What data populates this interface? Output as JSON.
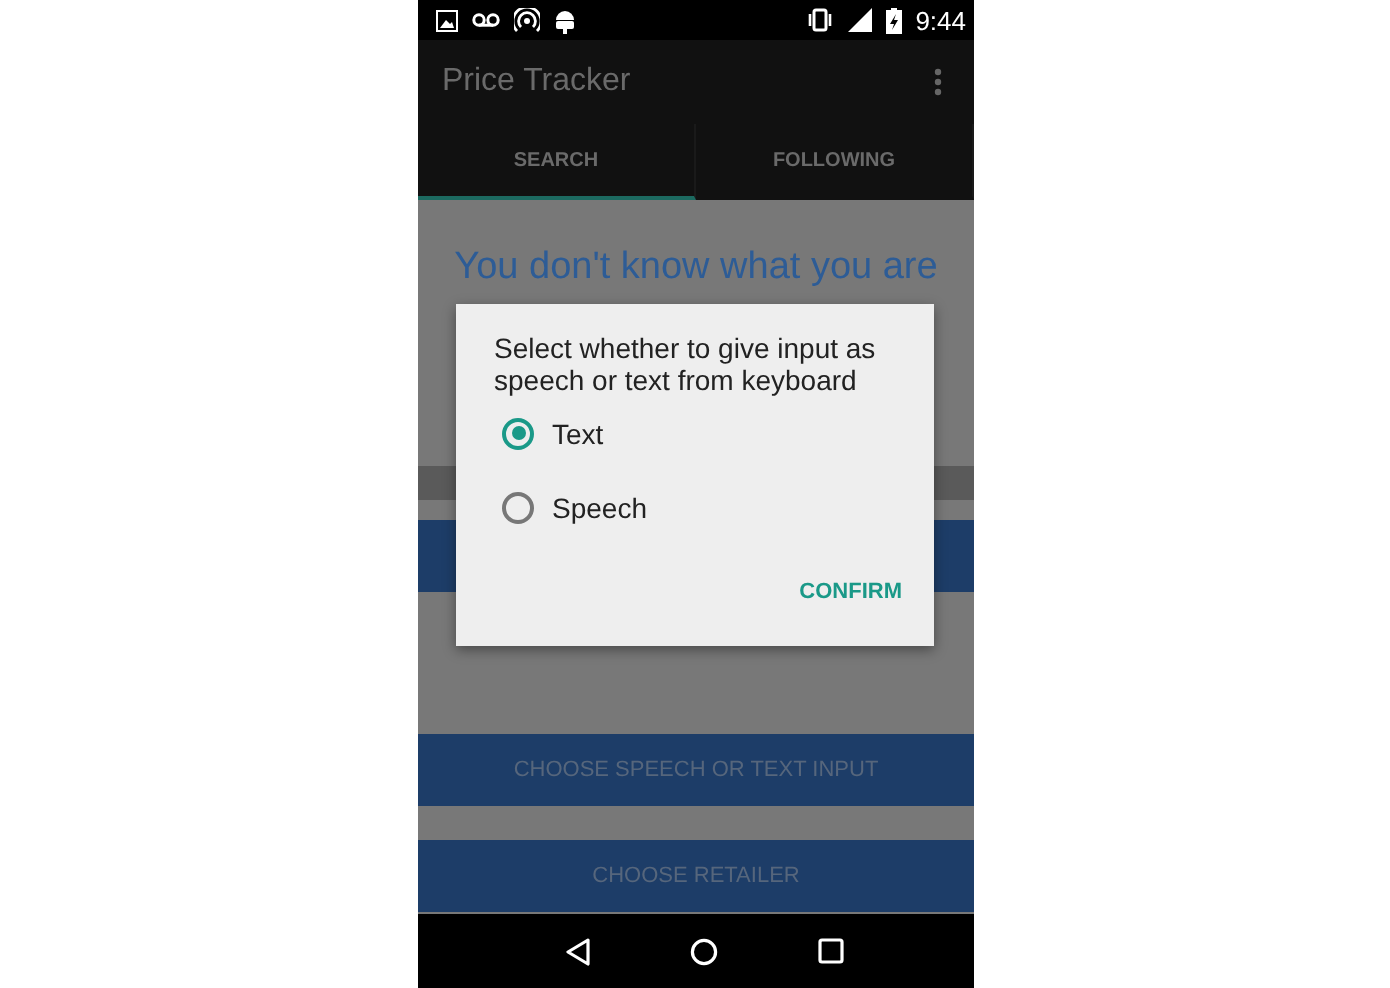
{
  "status_bar": {
    "time": "9:44"
  },
  "app_bar": {
    "title": "Price Tracker"
  },
  "tabs": [
    {
      "label": "SEARCH",
      "selected": true
    },
    {
      "label": "FOLLOWING",
      "selected": false
    }
  ],
  "content": {
    "heading": "You don't know what you are",
    "buttons": [
      "CHOOSE SPEECH OR TEXT INPUT",
      "CHOOSE RETAILER"
    ]
  },
  "dialog": {
    "title": "Select whether to give input as speech or text from keyboard",
    "options": [
      {
        "label": "Text",
        "selected": true
      },
      {
        "label": "Speech",
        "selected": false
      }
    ],
    "confirm": "CONFIRM"
  }
}
